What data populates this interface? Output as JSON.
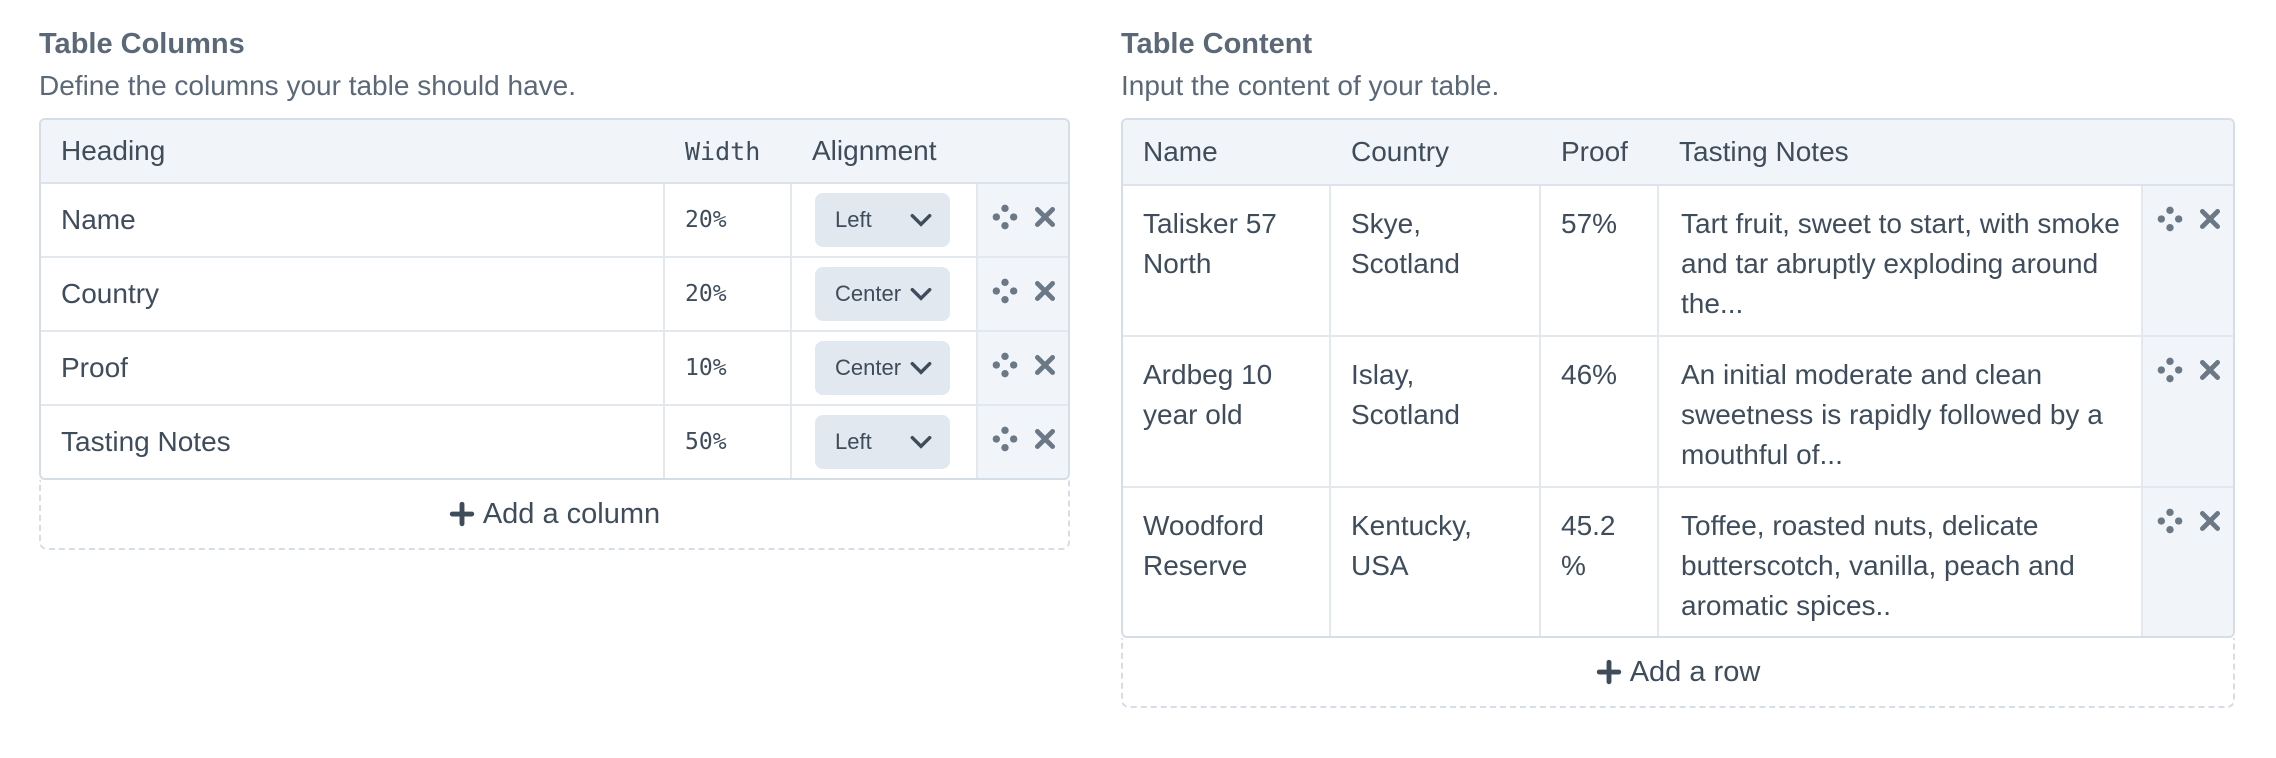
{
  "columns_panel": {
    "title": "Table Columns",
    "subtitle": "Define the columns your table should have.",
    "headers": {
      "heading": "Heading",
      "width": "Width",
      "alignment": "Alignment"
    },
    "rows": [
      {
        "heading": "Name",
        "width": "20%",
        "alignment": "Left"
      },
      {
        "heading": "Country",
        "width": "20%",
        "alignment": "Center"
      },
      {
        "heading": "Proof",
        "width": "10%",
        "alignment": "Center"
      },
      {
        "heading": "Tasting Notes",
        "width": "50%",
        "alignment": "Left"
      }
    ],
    "add_label": "Add a column"
  },
  "content_panel": {
    "title": "Table Content",
    "subtitle": "Input the content of your table.",
    "headers": [
      "Name",
      "Country",
      "Proof",
      "Tasting Notes"
    ],
    "rows": [
      [
        "Talisker 57 North",
        "Skye, Scotland",
        "57%",
        "Tart fruit, sweet to start, with smoke and tar abruptly exploding around the..."
      ],
      [
        "Ardbeg 10 year old",
        "Islay, Scotland",
        "46%",
        "An initial moderate and clean sweetness is rapidly followed by a mouthful of..."
      ],
      [
        "Woodford Reserve",
        "Kentucky, USA",
        "45.2 %",
        "Toffee, roasted nuts, delicate butterscotch, vanilla, peach and aromatic spices.."
      ]
    ],
    "add_label": "Add a row"
  },
  "icons": {
    "move": "move-icon",
    "remove": "close-icon",
    "add": "plus-icon",
    "dropdown": "chevron-down-icon"
  },
  "colors": {
    "text": "#3e4c5b",
    "header_bg": "#f1f5f9",
    "border": "#d5dde6",
    "select_bg": "#e2e8f0"
  }
}
